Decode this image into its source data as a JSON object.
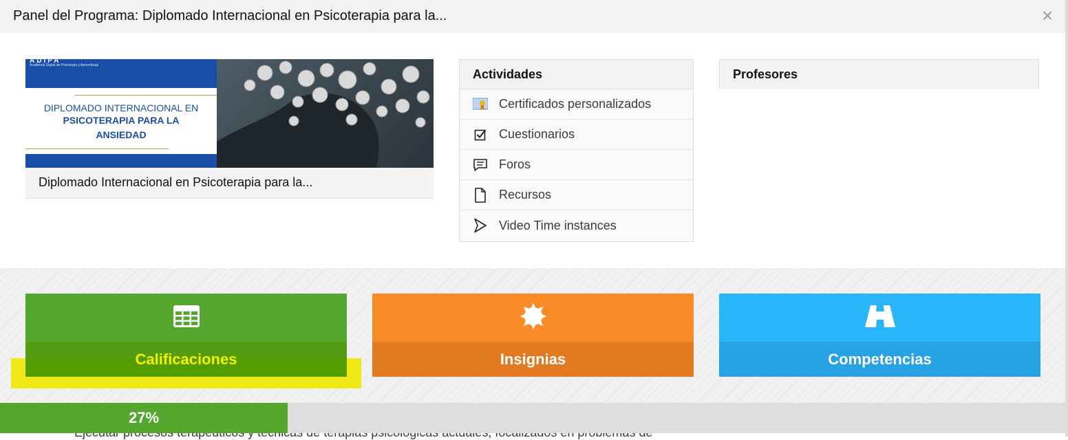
{
  "header": {
    "title": "Panel del Programa: Diplomado Internacional en Psicoterapia para la...",
    "close_icon": "×"
  },
  "course": {
    "image_text": {
      "logo": "ADIPA",
      "tagline": "Academia Digital de Psicología y Aprendizaje",
      "line1": "DIPLOMADO INTERNACIONAL EN",
      "line2": "PSICOTERAPIA PARA LA",
      "line3": "ANSIEDAD"
    },
    "name": "Diplomado Internacional en Psicoterapia para la..."
  },
  "activities": {
    "title": "Actividades",
    "items": [
      {
        "label": "Certificados personalizados",
        "icon": "certificate-icon"
      },
      {
        "label": "Cuestionarios",
        "icon": "quiz-checkbox-icon"
      },
      {
        "label": "Foros",
        "icon": "forum-icon"
      },
      {
        "label": "Recursos",
        "icon": "file-icon"
      },
      {
        "label": "Video Time instances",
        "icon": "play-icon"
      }
    ]
  },
  "teachers": {
    "title": "Profesores"
  },
  "tiles": {
    "grades": {
      "label": "Calificaciones",
      "icon": "table-icon",
      "color": "#54a62e"
    },
    "badges": {
      "label": "Insignias",
      "icon": "badge-icon",
      "color": "#f98b26"
    },
    "competencies": {
      "label": "Competencias",
      "icon": "road-icon",
      "color": "#2ab4f9"
    }
  },
  "progress": {
    "percent": 27,
    "label": "27%"
  },
  "below_text": "Ejecutar procesos terapéuticos y técnicas de terapias psicológicas actuales, focalizados en problemas de"
}
